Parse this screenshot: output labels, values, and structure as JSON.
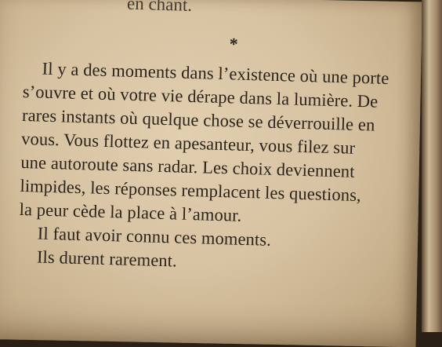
{
  "document": {
    "previous_line": "en chant.",
    "separator": "*",
    "lines": [
      "Il y a des moments dans l’existence où une porte",
      "s’ouvre et où votre vie dérape dans la lumière. De",
      "rares instants où quelque chose se déverrouille en",
      "vous. Vous flottez en apesanteur, vous filez sur",
      "une autoroute sans radar. Les choix deviennent",
      "limpides, les réponses remplacent les questions,",
      "la peur cède la place à l’amour.",
      "Il faut avoir connu ces moments.",
      "Ils durent rarement."
    ]
  }
}
